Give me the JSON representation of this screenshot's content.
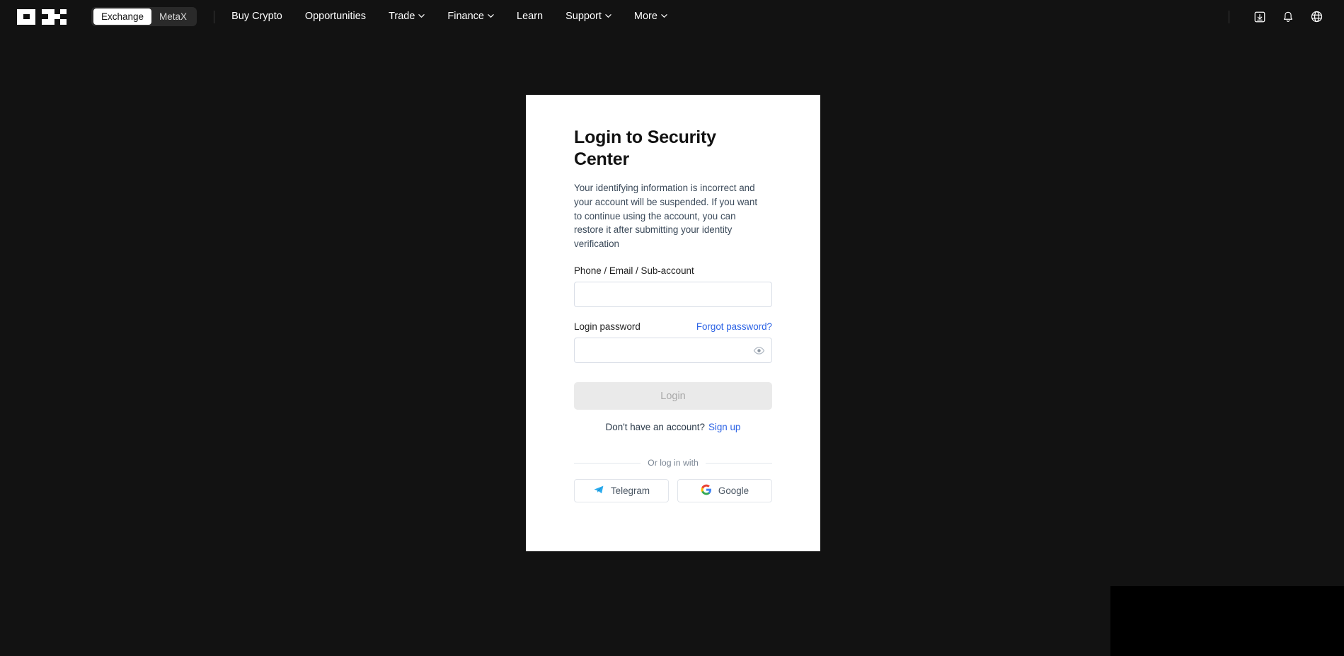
{
  "navbar": {
    "logo_name": "okx-logo",
    "segmented": {
      "active": "Exchange",
      "inactive": "MetaX"
    },
    "links": [
      {
        "label": "Buy Crypto",
        "has_chevron": false
      },
      {
        "label": "Opportunities",
        "has_chevron": false
      },
      {
        "label": "Trade",
        "has_chevron": true
      },
      {
        "label": "Finance",
        "has_chevron": true
      },
      {
        "label": "Learn",
        "has_chevron": false
      },
      {
        "label": "Support",
        "has_chevron": true
      },
      {
        "label": "More",
        "has_chevron": true
      }
    ],
    "icons": [
      {
        "name": "download-icon"
      },
      {
        "name": "bell-icon"
      },
      {
        "name": "globe-icon"
      }
    ]
  },
  "card": {
    "title": "Login to Security Center",
    "description": "Your identifying information is incorrect and your account will be suspended. If you want to continue using the account, you can restore it after submitting your identity verification",
    "account_field": {
      "label": "Phone / Email / Sub-account",
      "value": "",
      "placeholder": ""
    },
    "password_field": {
      "label": "Login password",
      "forgot_link": "Forgot password?",
      "value": "",
      "placeholder": "",
      "toggle_icon": "eye-icon"
    },
    "login_button": "Login",
    "signup_prompt": "Don't have an account?",
    "signup_link": "Sign up",
    "divider_text": "Or log in with",
    "social_buttons": [
      {
        "label": "Telegram",
        "icon": "telegram-icon"
      },
      {
        "label": "Google",
        "icon": "google-icon"
      }
    ]
  },
  "colors": {
    "page_background": "#121212",
    "card_background": "#ffffff",
    "link_blue": "#2c63e5",
    "disabled_button": "#eaeaea",
    "telegram_blue": "#2aabee",
    "bottom_panel": "#000000"
  }
}
